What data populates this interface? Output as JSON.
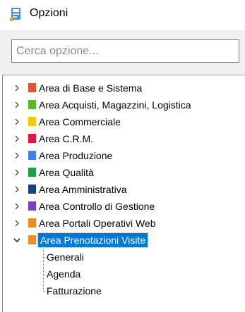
{
  "window": {
    "title": "Opzioni",
    "icon": "options-app-icon"
  },
  "search": {
    "placeholder": "Cerca opzione...",
    "value": ""
  },
  "tree": {
    "nodes": [
      {
        "label": "Area di Base e Sistema",
        "color": "#e0542f",
        "expanded": false
      },
      {
        "label": "Area Acquisti, Magazzini, Logistica",
        "color": "#55b82e",
        "expanded": false
      },
      {
        "label": "Area Commerciale",
        "color": "#f2c80f",
        "expanded": false
      },
      {
        "label": "Area C.R.M.",
        "color": "#e0183f",
        "expanded": false
      },
      {
        "label": "Area Produzione",
        "color": "#3b82f0",
        "expanded": false
      },
      {
        "label": "Area Qualità",
        "color": "#1e9e4a",
        "expanded": false
      },
      {
        "label": "Area Amministrativa",
        "color": "#1b3f7a",
        "expanded": false
      },
      {
        "label": "Area Controllo di Gestione",
        "color": "#7a3fc2",
        "expanded": false
      },
      {
        "label": "Area Portali Operativi Web",
        "color": "#ef8a1c",
        "expanded": false
      },
      {
        "label": "Area Prenotazioni Visite",
        "color": "#e8922a",
        "expanded": true,
        "selected": true
      }
    ],
    "children": [
      {
        "label": "Generali"
      },
      {
        "label": "Agenda"
      },
      {
        "label": "Fatturazione"
      }
    ]
  },
  "colors": {
    "selection": "#0078d7",
    "panel_bg": "#f0f0f0"
  }
}
